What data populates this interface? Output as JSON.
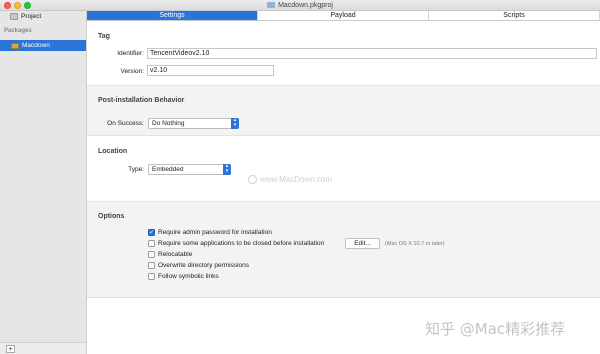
{
  "window": {
    "title": "Macdown.pkgproj"
  },
  "sidebar": {
    "project_label": "Project",
    "packages_header": "Packages",
    "selected_package": "Macdown",
    "add_label": "+"
  },
  "tabs": [
    {
      "label": "Settings",
      "active": true
    },
    {
      "label": "Payload",
      "active": false
    },
    {
      "label": "Scripts",
      "active": false
    }
  ],
  "tag": {
    "title": "Tag",
    "identifier_label": "Identifier:",
    "identifier_value": "TencentVideov2.10",
    "version_label": "Version:",
    "version_value": "v2.10"
  },
  "post_install": {
    "title": "Post-installation Behavior",
    "on_success_label": "On Success:",
    "on_success_value": "Do Nothing"
  },
  "location": {
    "title": "Location",
    "type_label": "Type:",
    "type_value": "Embedded"
  },
  "options": {
    "title": "Options",
    "items": [
      {
        "label": "Require admin password for installation",
        "checked": true
      },
      {
        "label": "Require some applications to be closed before installation",
        "checked": false
      },
      {
        "label": "Relocatable",
        "checked": false
      },
      {
        "label": "Overwrite directory permissions",
        "checked": false
      },
      {
        "label": "Follow symbolic links",
        "checked": false
      }
    ],
    "edit_button": "Edit...",
    "edit_note": "(Mac OS X 10.7 or later)"
  },
  "watermarks": {
    "site": "www.MacDown.com",
    "brand": "知乎 @Mac精彩推荐"
  },
  "colors": {
    "accent": "#2b74d8",
    "close": "#fc5f57",
    "minimize": "#fdbc2e",
    "maximize": "#28c840"
  }
}
